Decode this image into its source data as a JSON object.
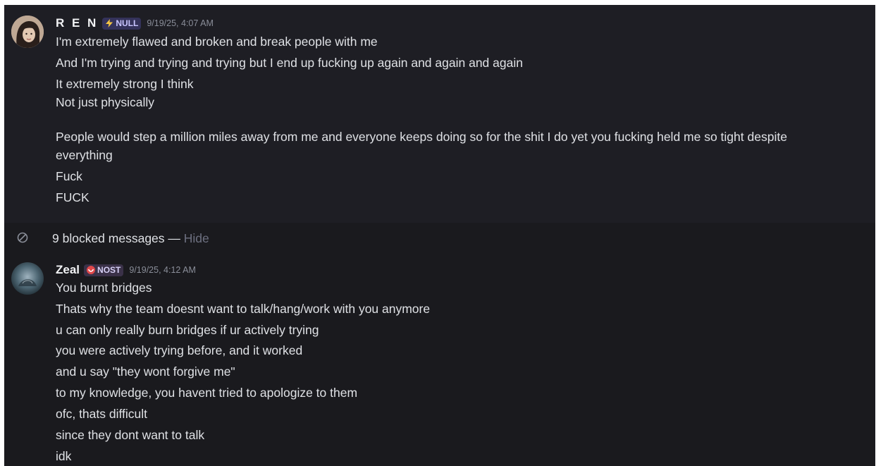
{
  "messages": [
    {
      "username": "R E N",
      "tag": "NULL",
      "tag_icon": "lightning-icon",
      "timestamp": "9/19/25, 4:07 AM",
      "avatar_icon": "user-avatar-portrait",
      "lines": [
        "I'm extremely flawed and broken and break people with me",
        "And I'm trying and trying and trying but I end up fucking up again and again and again",
        "It extremely strong I think",
        "Not just physically",
        "",
        "People would step a million miles away from me and everyone keeps doing so for the shit I do yet you fucking held me so tight despite everything",
        "Fuck",
        "FUCK"
      ]
    },
    {
      "username": "Zeal",
      "tag": "NOST",
      "tag_icon": "red-badge-icon",
      "timestamp": "9/19/25, 4:12 AM",
      "avatar_icon": "user-avatar-dark-scene",
      "lines": [
        "You burnt bridges",
        "Thats why the team doesnt want to talk/hang/work with you anymore",
        "u can only really burn bridges if ur actively trying",
        "you were actively trying before, and it worked",
        "and u say \"they wont forgive me\"",
        "to my knowledge, you havent tried to apologize to them",
        "ofc, thats difficult",
        "since they dont want to talk",
        "idk"
      ]
    }
  ],
  "blocked": {
    "text": "9 blocked messages — ",
    "action": "Hide",
    "icon": "blocked-circle-icon"
  },
  "colors": {
    "background": "#1a1a1e",
    "highlight": "#1e1e24",
    "text": "#dfe1e5",
    "muted": "#8a8e99",
    "tag_bg": "#34325a"
  }
}
